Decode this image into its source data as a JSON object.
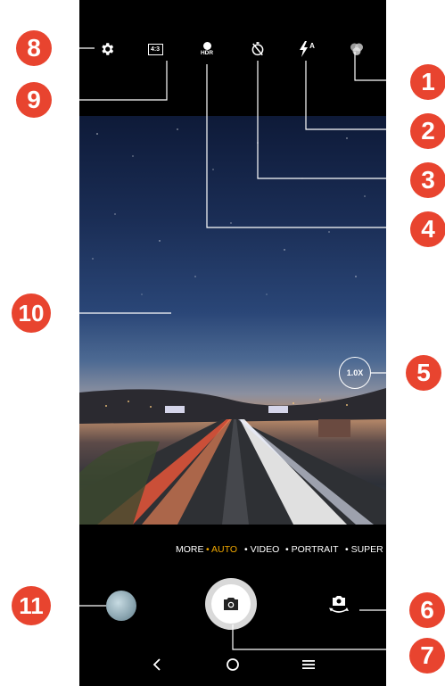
{
  "top_bar": {
    "icons": [
      "gear-icon",
      "aspect-ratio-icon",
      "hdr-icon",
      "timer-off-icon",
      "flash-auto-icon",
      "filter-icon"
    ],
    "aspect_label": "4:3",
    "hdr_label": "HDR",
    "flash_label": "A"
  },
  "preview": {
    "zoom_label": "1.0X"
  },
  "modes": {
    "items": [
      "MORE",
      "• AUTO",
      "• VIDEO",
      "• PORTRAIT",
      "• SUPER"
    ],
    "active": "AUTO"
  },
  "callouts": [
    "1",
    "2",
    "3",
    "4",
    "5",
    "6",
    "7",
    "8",
    "9",
    "10",
    "11"
  ],
  "colors": {
    "callout": "#e8442f",
    "active_mode": "#f2a900",
    "background": "#000000"
  }
}
